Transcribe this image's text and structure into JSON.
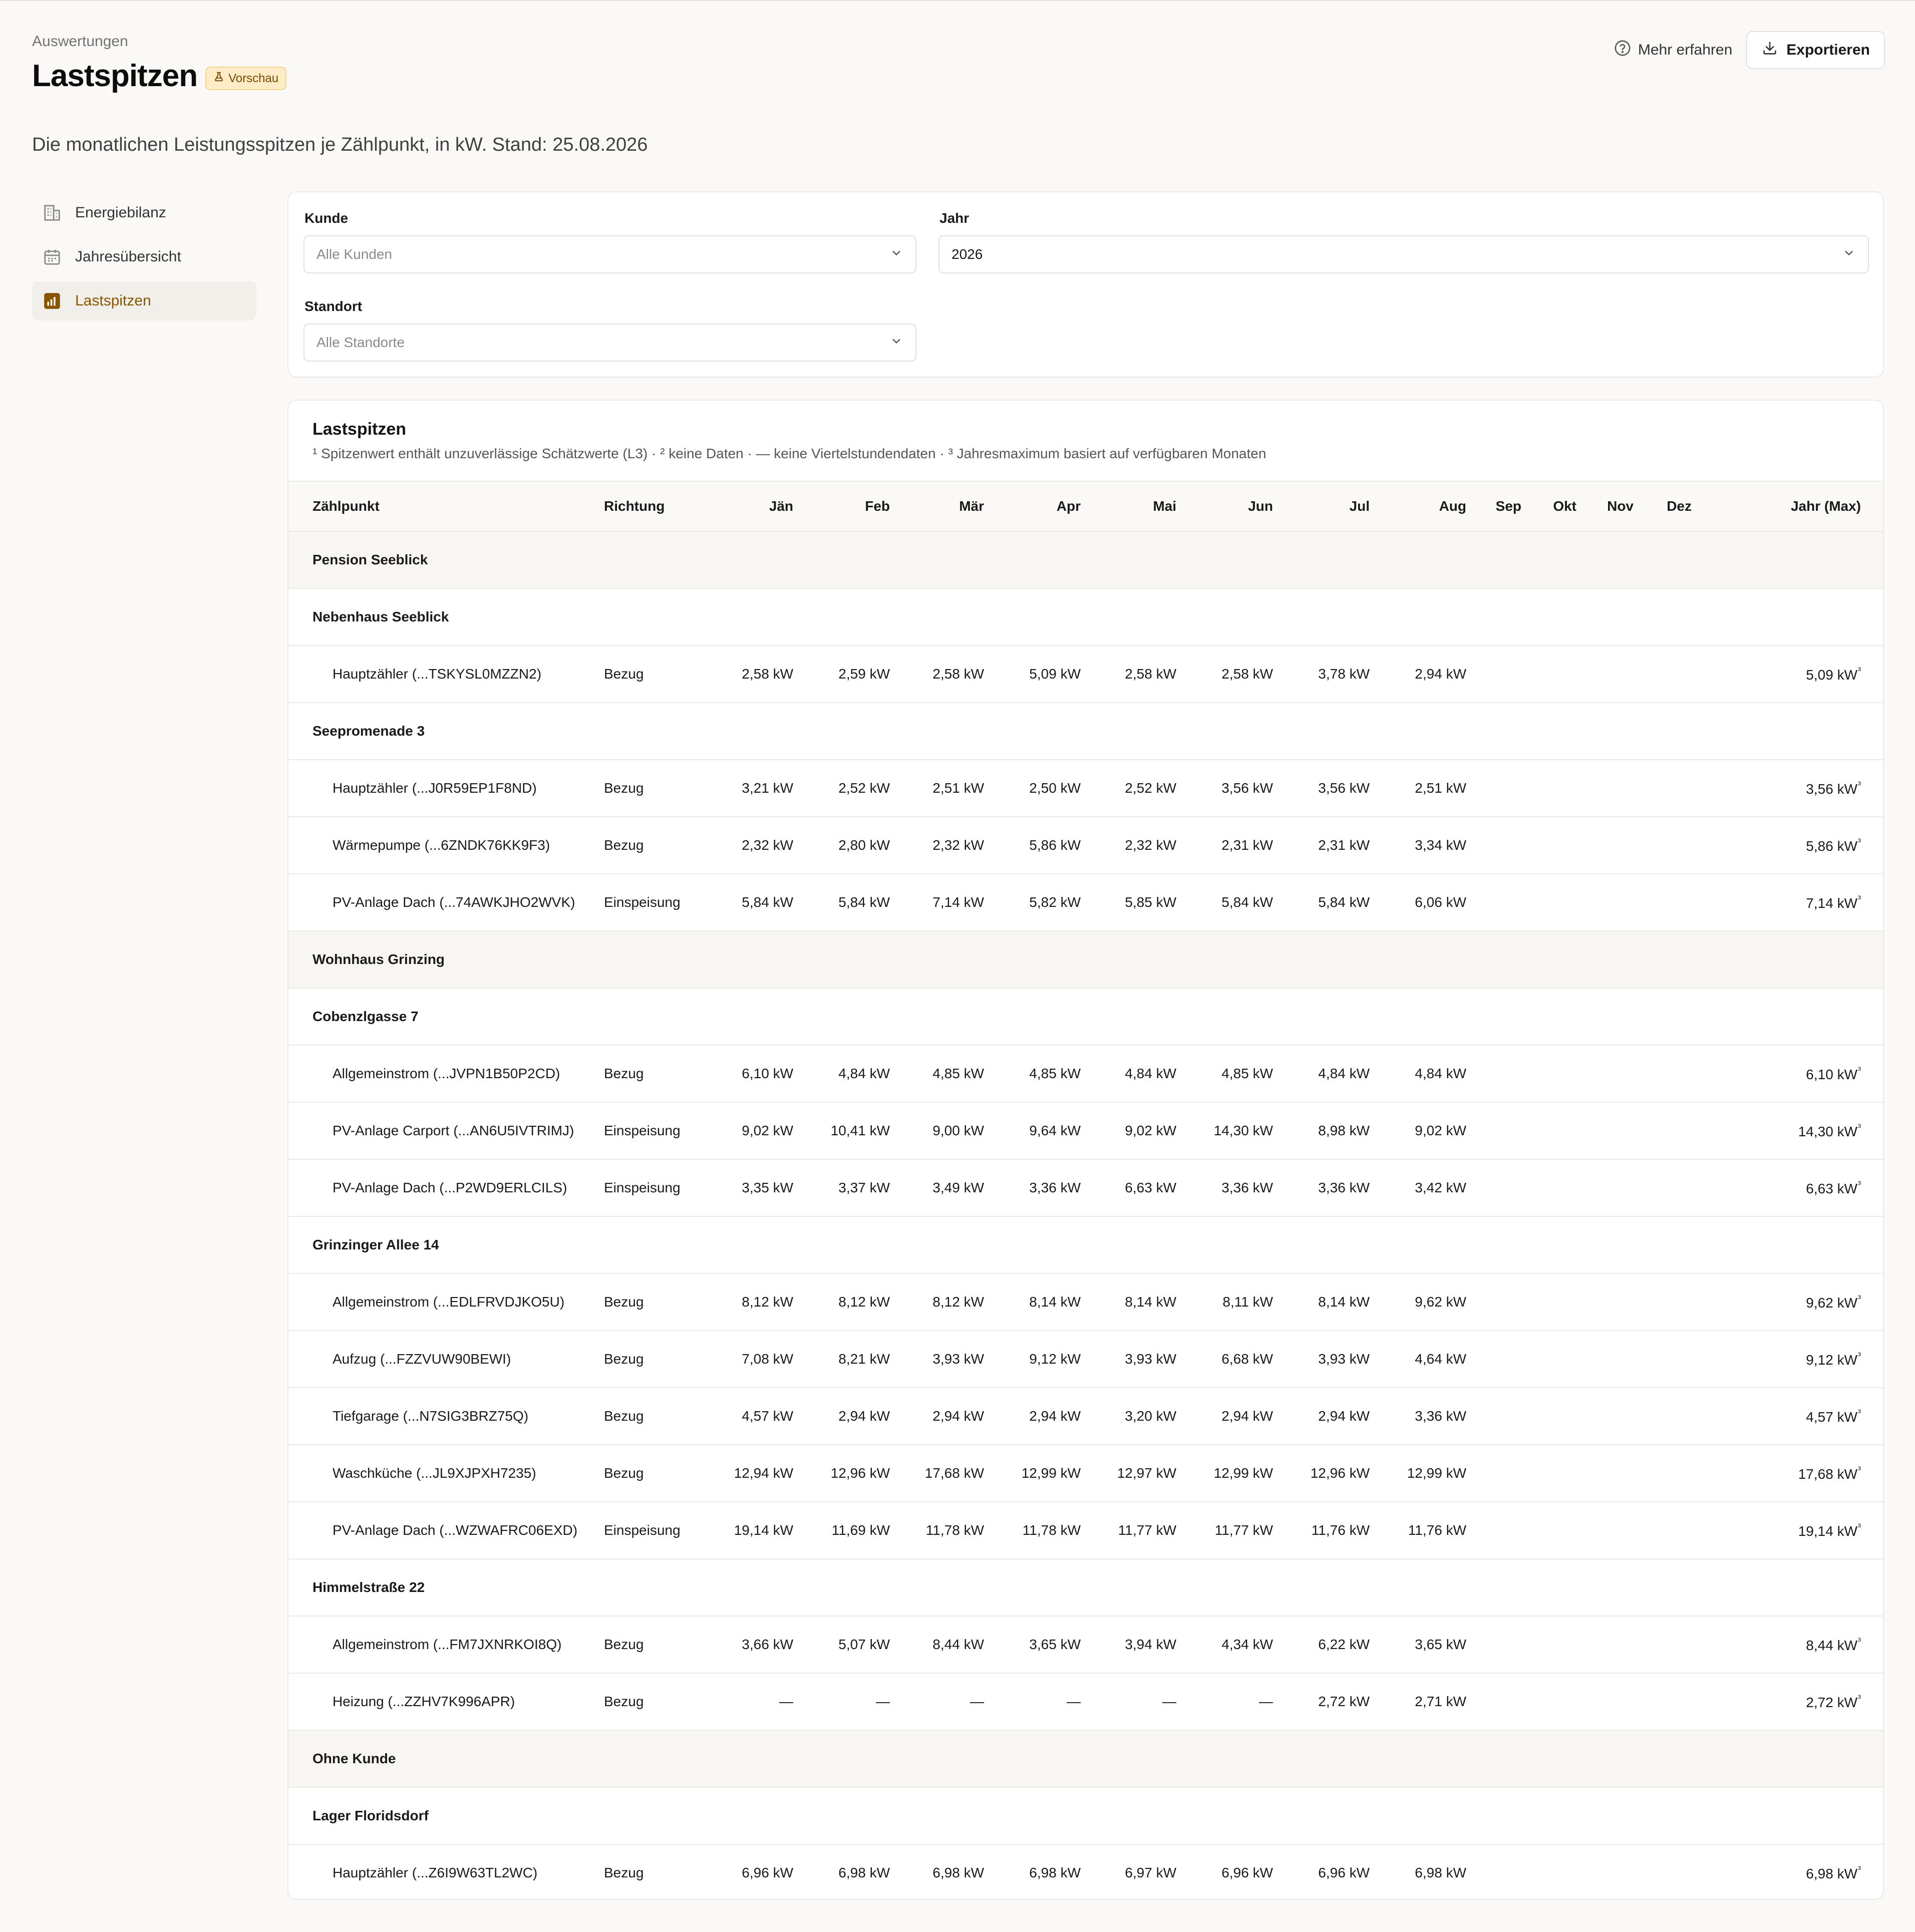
{
  "header": {
    "eyebrow": "Auswertungen",
    "title": "Lastspitzen",
    "badge": "Vorschau",
    "subtitle": "Die monatlichen Leistungsspitzen je Zählpunkt, in kW. Stand: 25.08.2026",
    "learn_more": "Mehr erfahren",
    "export": "Exportieren"
  },
  "sidebar": {
    "items": [
      {
        "label": "Energiebilanz",
        "icon": "building-icon"
      },
      {
        "label": "Jahresübersicht",
        "icon": "calendar-icon"
      },
      {
        "label": "Lastspitzen",
        "icon": "bar-chart-icon",
        "active": true
      }
    ]
  },
  "filters": {
    "customer_label": "Kunde",
    "customer_placeholder": "Alle Kunden",
    "year_label": "Jahr",
    "year_value": "2026",
    "location_label": "Standort",
    "location_placeholder": "Alle Standorte"
  },
  "table": {
    "title": "Lastspitzen",
    "note": "¹ Spitzenwert enthält unzuverlässige Schätzwerte (L3) · ² keine Daten · — keine Viertelstundendaten · ³ Jahresmaximum basiert auf verfügbaren Monaten",
    "columns": [
      "Zählpunkt",
      "Richtung",
      "Jän",
      "Feb",
      "Mär",
      "Apr",
      "Mai",
      "Jun",
      "Jul",
      "Aug",
      "Sep",
      "Okt",
      "Nov",
      "Dez",
      "Jahr (Max)"
    ],
    "rows": [
      {
        "kind": "customer",
        "label": "Pension Seeblick"
      },
      {
        "kind": "site",
        "label": "Nebenhaus Seeblick"
      },
      {
        "kind": "meter",
        "name": "Hauptzähler (...TSKYSL0MZZN2)",
        "direction": "Bezug",
        "values": [
          "2,58 kW",
          "2,59 kW",
          "2,58 kW",
          "5,09 kW",
          "2,58 kW",
          "2,58 kW",
          "3,78 kW",
          "2,94 kW",
          "",
          "",
          "",
          ""
        ],
        "max": "5,09 kW",
        "max_mark": "³"
      },
      {
        "kind": "site",
        "label": "Seepromenade 3"
      },
      {
        "kind": "meter",
        "name": "Hauptzähler (...J0R59EP1F8ND)",
        "direction": "Bezug",
        "values": [
          "3,21 kW",
          "2,52 kW",
          "2,51 kW",
          "2,50 kW",
          "2,52 kW",
          "3,56 kW",
          "3,56 kW",
          "2,51 kW",
          "",
          "",
          "",
          ""
        ],
        "max": "3,56 kW",
        "max_mark": "³"
      },
      {
        "kind": "meter",
        "name": "Wärmepumpe (...6ZNDK76KK9F3)",
        "direction": "Bezug",
        "values": [
          "2,32 kW",
          "2,80 kW",
          "2,32 kW",
          "5,86 kW",
          "2,32 kW",
          "2,31 kW",
          "2,31 kW",
          "3,34 kW",
          "",
          "",
          "",
          ""
        ],
        "max": "5,86 kW",
        "max_mark": "³"
      },
      {
        "kind": "meter",
        "name": "PV-Anlage Dach (...74AWKJHO2WVK)",
        "direction": "Einspeisung",
        "values": [
          "5,84 kW",
          "5,84 kW",
          "7,14 kW",
          "5,82 kW",
          "5,85 kW",
          "5,84 kW",
          "5,84 kW",
          "6,06 kW",
          "",
          "",
          "",
          ""
        ],
        "max": "7,14 kW",
        "max_mark": "³"
      },
      {
        "kind": "customer",
        "label": "Wohnhaus Grinzing"
      },
      {
        "kind": "site",
        "label": "Cobenzlgasse 7"
      },
      {
        "kind": "meter",
        "name": "Allgemeinstrom (...JVPN1B50P2CD)",
        "direction": "Bezug",
        "values": [
          "6,10 kW",
          "4,84 kW",
          "4,85 kW",
          "4,85 kW",
          "4,84 kW",
          "4,85 kW",
          "4,84 kW",
          "4,84 kW",
          "",
          "",
          "",
          ""
        ],
        "max": "6,10 kW",
        "max_mark": "³"
      },
      {
        "kind": "meter",
        "name": "PV-Anlage Carport (...AN6U5IVTRIMJ)",
        "direction": "Einspeisung",
        "values": [
          "9,02 kW",
          "10,41 kW",
          "9,00 kW",
          "9,64 kW",
          "9,02 kW",
          "14,30 kW",
          "8,98 kW",
          "9,02 kW",
          "",
          "",
          "",
          ""
        ],
        "max": "14,30 kW",
        "max_mark": "³"
      },
      {
        "kind": "meter",
        "name": "PV-Anlage Dach (...P2WD9ERLCILS)",
        "direction": "Einspeisung",
        "values": [
          "3,35 kW",
          "3,37 kW",
          "3,49 kW",
          "3,36 kW",
          "6,63 kW",
          "3,36 kW",
          "3,36 kW",
          "3,42 kW",
          "",
          "",
          "",
          ""
        ],
        "max": "6,63 kW",
        "max_mark": "³"
      },
      {
        "kind": "site",
        "label": "Grinzinger Allee 14"
      },
      {
        "kind": "meter",
        "name": "Allgemeinstrom (...EDLFRVDJKO5U)",
        "direction": "Bezug",
        "values": [
          "8,12 kW",
          "8,12 kW",
          "8,12 kW",
          "8,14 kW",
          "8,14 kW",
          "8,11 kW",
          "8,14 kW",
          "9,62 kW",
          "",
          "",
          "",
          ""
        ],
        "max": "9,62 kW",
        "max_mark": "³"
      },
      {
        "kind": "meter",
        "name": "Aufzug (...FZZVUW90BEWI)",
        "direction": "Bezug",
        "values": [
          "7,08 kW",
          "8,21 kW",
          "3,93 kW",
          "9,12 kW",
          "3,93 kW",
          "6,68 kW",
          "3,93 kW",
          "4,64 kW",
          "",
          "",
          "",
          ""
        ],
        "max": "9,12 kW",
        "max_mark": "³"
      },
      {
        "kind": "meter",
        "name": "Tiefgarage (...N7SIG3BRZ75Q)",
        "direction": "Bezug",
        "values": [
          "4,57 kW",
          "2,94 kW",
          "2,94 kW",
          "2,94 kW",
          "3,20 kW",
          "2,94 kW",
          "2,94 kW",
          "3,36 kW",
          "",
          "",
          "",
          ""
        ],
        "max": "4,57 kW",
        "max_mark": "³"
      },
      {
        "kind": "meter",
        "name": "Waschküche (...JL9XJPXH7235)",
        "direction": "Bezug",
        "values": [
          "12,94 kW",
          "12,96 kW",
          "17,68 kW",
          "12,99 kW",
          "12,97 kW",
          "12,99 kW",
          "12,96 kW",
          "12,99 kW",
          "",
          "",
          "",
          ""
        ],
        "max": "17,68 kW",
        "max_mark": "³"
      },
      {
        "kind": "meter",
        "name": "PV-Anlage Dach (...WZWAFRC06EXD)",
        "direction": "Einspeisung",
        "values": [
          "19,14 kW",
          "11,69 kW",
          "11,78 kW",
          "11,78 kW",
          "11,77 kW",
          "11,77 kW",
          "11,76 kW",
          "11,76 kW",
          "",
          "",
          "",
          ""
        ],
        "max": "19,14 kW",
        "max_mark": "³"
      },
      {
        "kind": "site",
        "label": "Himmelstraße 22"
      },
      {
        "kind": "meter",
        "name": "Allgemeinstrom (...FM7JXNRKOI8Q)",
        "direction": "Bezug",
        "values": [
          "3,66 kW",
          "5,07 kW",
          "8,44 kW",
          "3,65 kW",
          "3,94 kW",
          "4,34 kW",
          "6,22 kW",
          "3,65 kW",
          "",
          "",
          "",
          ""
        ],
        "max": "8,44 kW",
        "max_mark": "³"
      },
      {
        "kind": "meter",
        "name": "Heizung (...ZZHV7K996APR)",
        "direction": "Bezug",
        "values": [
          "—",
          "—",
          "—",
          "—",
          "—",
          "—",
          "2,72 kW",
          "2,71 kW",
          "",
          "",
          "",
          ""
        ],
        "max": "2,72 kW",
        "max_mark": "³"
      },
      {
        "kind": "customer",
        "label": "Ohne Kunde"
      },
      {
        "kind": "site",
        "label": "Lager Floridsdorf"
      },
      {
        "kind": "meter",
        "name": "Hauptzähler (...Z6I9W63TL2WC)",
        "direction": "Bezug",
        "values": [
          "6,96 kW",
          "6,98 kW",
          "6,98 kW",
          "6,98 kW",
          "6,97 kW",
          "6,96 kW",
          "6,96 kW",
          "6,98 kW",
          "",
          "",
          "",
          ""
        ],
        "max": "6,98 kW",
        "max_mark": "³"
      }
    ]
  },
  "colors": {
    "accent": "#8a5500",
    "badge_bg": "#fdecc6",
    "group_bg": "#f7f6f3"
  }
}
